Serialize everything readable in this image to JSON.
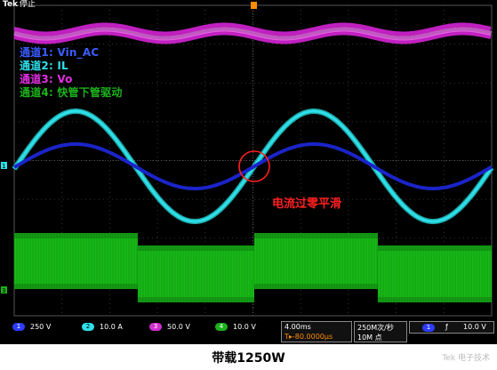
{
  "scope": {
    "brand": "Tek",
    "run_state": "停止",
    "legend": [
      {
        "label": "通道1: Vin_AC",
        "color": "#3a5cff"
      },
      {
        "label": "通道2: IL",
        "color": "#2ee0ea"
      },
      {
        "label": "通道3: Vo",
        "color": "#e030e0"
      },
      {
        "label": "通道4: 快管下管驱动",
        "color": "#1bb31b"
      }
    ],
    "annotation": "电流过零平滑",
    "ch1_marker": "1",
    "ch3_marker": "3",
    "status": {
      "ch1": {
        "num": "1",
        "scale": "250 V",
        "color": "#2d3cff"
      },
      "ch2": {
        "num": "2",
        "scale": "10.0 A",
        "color": "#2ee0ea"
      },
      "ch3": {
        "num": "3",
        "scale": "50.0 V",
        "color": "#d030d0"
      },
      "ch4": {
        "num": "4",
        "scale": "10.0 V",
        "color": "#1bb31b"
      },
      "timebase": "4.00ms",
      "trigger_pos": "T▸-80.0000µs",
      "sample_rate": "250M次/秒",
      "record_length": "10M 点",
      "trigger_ch": "1",
      "trigger_slope": "ƒ",
      "trigger_level": "10.0 V"
    }
  },
  "caption": "带载1250W",
  "watermark": "Tek 电子技术"
}
